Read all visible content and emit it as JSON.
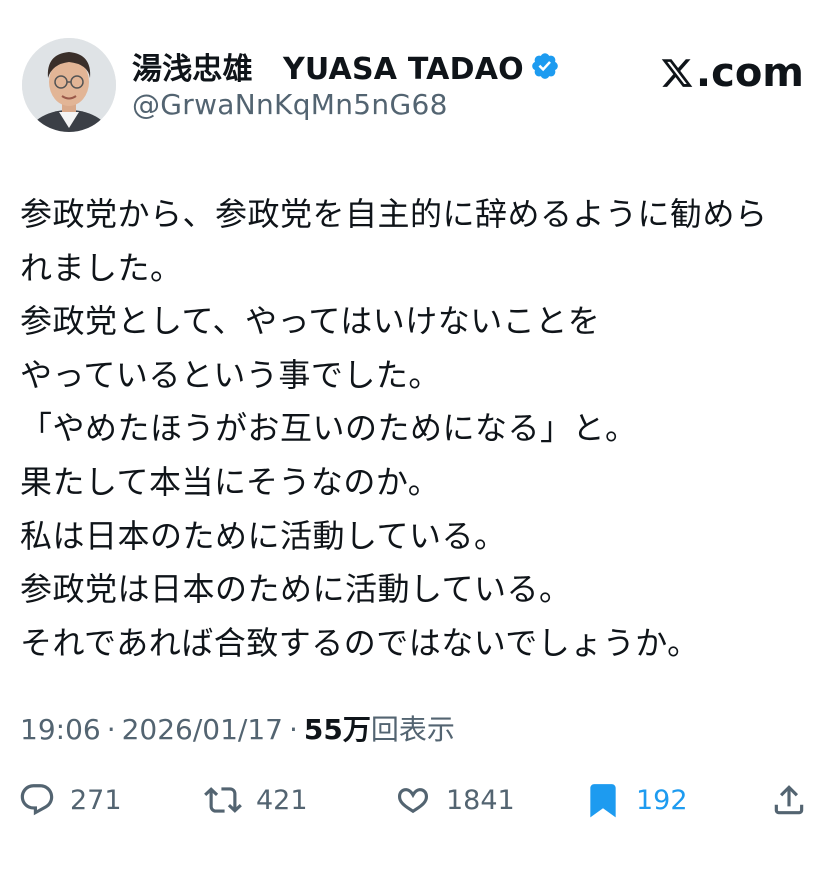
{
  "author": {
    "display_name": "湯浅忠雄　YUASA TADAO",
    "handle": "@GrwaNnKqMn5nG68",
    "verified": true,
    "avatar_icon": "profile-photo"
  },
  "brand": {
    "label": ".com",
    "icon": "x-logo-icon"
  },
  "post": {
    "lines": [
      "参政党から、参政党を自主的に辞めるように勧めら",
      "れました。",
      "参政党として、やってはいけないことを",
      "やっているという事でした。",
      "「やめたほうがお互いのためになる」と。",
      "果たして本当にそうなのか。",
      "私は日本のために活動している。",
      "参政党は日本のために活動している。",
      "それであれば合致するのではないでしょうか。"
    ]
  },
  "meta": {
    "time": "19:06",
    "separator": "·",
    "date": "2026/01/17",
    "views_number": "55万",
    "views_label": "回表示"
  },
  "actions": {
    "replies": "271",
    "reposts": "421",
    "likes": "1841",
    "bookmarks": "192"
  },
  "colors": {
    "text": "#0f1419",
    "secondary": "#536471",
    "accent": "#1d9bf0"
  }
}
